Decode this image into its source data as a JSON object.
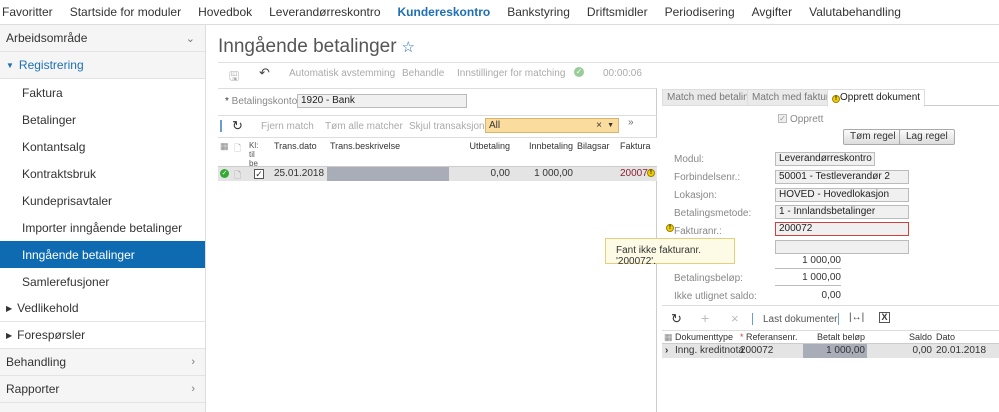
{
  "topnav": [
    "Favoritter",
    "Startside for moduler",
    "Hovedbok",
    "Leverandørreskontro",
    "Kundereskontro",
    "Bankstyring",
    "Driftsmidler",
    "Periodisering",
    "Avgifter",
    "Valutabehandling"
  ],
  "topnav_active": "Kundereskontro",
  "sidebar": {
    "workspace": "Arbeidsområde",
    "section": "Registrering",
    "items": [
      "Faktura",
      "Betalinger",
      "Kontantsalg",
      "Kontraktsbruk",
      "Kundeprisavtaler",
      "Importer inngående betalinger",
      "Inngående betalinger",
      "Samlerefusjoner"
    ],
    "active": "Inngående betalinger",
    "vedlikehold": "Vedlikehold",
    "foresporsler": "Forespørsler",
    "behandling": "Behandling",
    "rapporter": "Rapporter"
  },
  "page": {
    "title": "Inngående betalinger",
    "toolbar": {
      "auto": "Automatisk avstemming",
      "behandle": "Behandle",
      "settings": "Innstillinger for matching",
      "timer": "00:00:06"
    },
    "account_label": "Betalingskonto:",
    "account_value": "1920 - Bank"
  },
  "grid": {
    "toolbar": {
      "remove": "Fjern match",
      "clear": "Tøm alle matcher",
      "hide": "Skjul transaksjon",
      "filter": "All"
    },
    "headers": {
      "ready": "Kl: til be",
      "date": "Trans.dato",
      "desc": "Trans.beskrivelse",
      "out": "Utbetaling",
      "in": "Innbetaling",
      "voucher": "Bilagsar",
      "invoice": "Faktura"
    },
    "rows": [
      {
        "date": "25.01.2018",
        "desc": "",
        "out": "0,00",
        "in": "1 000,00",
        "voucher": "",
        "invoice": "200072"
      }
    ]
  },
  "right": {
    "tabs": [
      "Match med betaling",
      "Match med faktura",
      "Opprett dokument"
    ],
    "create": "Opprett",
    "btn_clear": "Tøm regel",
    "btn_make": "Lag regel",
    "fields": {
      "modul_label": "Modul:",
      "modul": "Leverandørreskontro",
      "forb_label": "Forbindelsenr.:",
      "forb": "50001 - Testleverandør 2",
      "lok_label": "Lokasjon:",
      "lok": "HOVED - Hovedlokasjon",
      "bet_label": "Betalingsmetode:",
      "bet": "1 - Innlandsbetalinger",
      "fakt_label": "Fakturanr.:",
      "fakt": "200072",
      "amount1": "1 000,00",
      "betbel_label": "Betalingsbeløp:",
      "betbel": "1 000,00",
      "saldo_label": "Ikke utlignet saldo:",
      "saldo": "0,00"
    },
    "tooltip": "Fant ikke fakturanr. '200072'.",
    "doc_toolbar": {
      "load": "Last dokumenter"
    },
    "doc_headers": {
      "type": "Dokumenttype",
      "ref": "Referansenr.",
      "paid": "Betalt beløp",
      "saldo": "Saldo",
      "date": "Dato"
    },
    "doc_rows": [
      {
        "type": "Inng. kreditnota",
        "ref": "200072",
        "paid": "1 000,00",
        "saldo": "0,00",
        "date": "20.01.2018"
      }
    ]
  },
  "colors": {
    "accent": "#0e6bb2",
    "error": "#d04040",
    "warn": "#f0d000"
  }
}
